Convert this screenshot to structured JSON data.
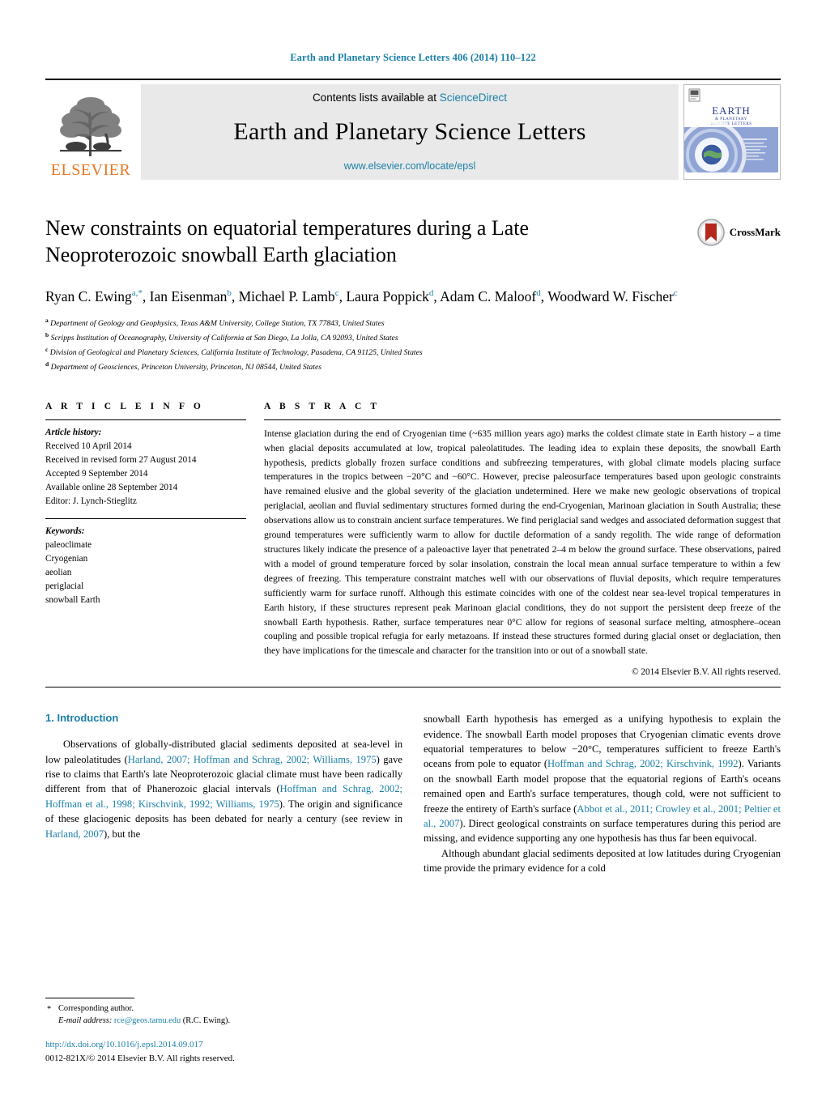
{
  "running_head": "Earth and Planetary Science Letters 406 (2014) 110–122",
  "banner": {
    "contents_prefix": "Contents lists available at ",
    "contents_link": "ScienceDirect",
    "journal_name": "Earth and Planetary Science Letters",
    "journal_url": "www.elsevier.com/locate/epsl",
    "publisher": "ELSEVIER",
    "cover_title_line1": "EARTH",
    "cover_title_line2": "& PLANETARY",
    "cover_title_line3": "SCIENCE LETTERS"
  },
  "article": {
    "title": "New constraints on equatorial temperatures during a Late Neoproterozoic snowball Earth glaciation",
    "crossmark_label": "CrossMark",
    "authors_line1": "Ryan C. Ewing",
    "authors": [
      {
        "name": "Ryan C. Ewing",
        "marks": "a,*"
      },
      {
        "name": "Ian Eisenman",
        "marks": "b"
      },
      {
        "name": "Michael P. Lamb",
        "marks": "c"
      },
      {
        "name": "Laura Poppick",
        "marks": "d"
      },
      {
        "name": "Adam C. Maloof",
        "marks": "d"
      },
      {
        "name": "Woodward W. Fischer",
        "marks": "c"
      }
    ],
    "affiliations": [
      {
        "mark": "a",
        "text": "Department of Geology and Geophysics, Texas A&M University, College Station, TX 77843, United States"
      },
      {
        "mark": "b",
        "text": "Scripps Institution of Oceanography, University of California at San Diego, La Jolla, CA 92093, United States"
      },
      {
        "mark": "c",
        "text": "Division of Geological and Planetary Sciences, California Institute of Technology, Pasadena, CA 91125, United States"
      },
      {
        "mark": "d",
        "text": "Department of Geosciences, Princeton University, Princeton, NJ 08544, United States"
      }
    ]
  },
  "article_info": {
    "heading": "A R T I C L E   I N F O",
    "history_label": "Article history:",
    "history": [
      "Received 10 April 2014",
      "Received in revised form 27 August 2014",
      "Accepted 9 September 2014",
      "Available online 28 September 2014",
      "Editor: J. Lynch-Stieglitz"
    ],
    "keywords_label": "Keywords:",
    "keywords": [
      "paleoclimate",
      "Cryogenian",
      "aeolian",
      "periglacial",
      "snowball Earth"
    ]
  },
  "abstract": {
    "heading": "A B S T R A C T",
    "text": "Intense glaciation during the end of Cryogenian time (~635 million years ago) marks the coldest climate state in Earth history – a time when glacial deposits accumulated at low, tropical paleolatitudes. The leading idea to explain these deposits, the snowball Earth hypothesis, predicts globally frozen surface conditions and subfreezing temperatures, with global climate models placing surface temperatures in the tropics between −20°C and −60°C. However, precise paleosurface temperatures based upon geologic constraints have remained elusive and the global severity of the glaciation undetermined. Here we make new geologic observations of tropical periglacial, aeolian and fluvial sedimentary structures formed during the end-Cryogenian, Marinoan glaciation in South Australia; these observations allow us to constrain ancient surface temperatures. We find periglacial sand wedges and associated deformation suggest that ground temperatures were sufficiently warm to allow for ductile deformation of a sandy regolith. The wide range of deformation structures likely indicate the presence of a paleoactive layer that penetrated 2–4 m below the ground surface. These observations, paired with a model of ground temperature forced by solar insolation, constrain the local mean annual surface temperature to within a few degrees of freezing. This temperature constraint matches well with our observations of fluvial deposits, which require temperatures sufficiently warm for surface runoff. Although this estimate coincides with one of the coldest near sea-level tropical temperatures in Earth history, if these structures represent peak Marinoan glacial conditions, they do not support the persistent deep freeze of the snowball Earth hypothesis. Rather, surface temperatures near 0°C allow for regions of seasonal surface melting, atmosphere–ocean coupling and possible tropical refugia for early metazoans. If instead these structures formed during glacial onset or deglaciation, then they have implications for the timescale and character for the transition into or out of a snowball state.",
    "copyright": "© 2014 Elsevier B.V. All rights reserved."
  },
  "body": {
    "section_heading": "1. Introduction",
    "left_paragraph_part1": "Observations of globally-distributed glacial sediments deposited at sea-level in low paleolatitudes (",
    "left_ref1": "Harland, 2007; Hoffman and Schrag, 2002; Williams, 1975",
    "left_paragraph_part2": ") gave rise to claims that Earth's late Neoproterozoic glacial climate must have been radically different from that of Phanerozoic glacial intervals (",
    "left_ref2": "Hoffman and Schrag, 2002; Hoffman et al., 1998; Kirschvink, 1992; Williams, 1975",
    "left_paragraph_part3": "). The origin and significance of these glaciogenic deposits has been debated for nearly a century (see review in ",
    "left_ref3": "Harland, 2007",
    "left_paragraph_part4": "), but the",
    "right_paragraph1_part1": "snowball Earth hypothesis has emerged as a unifying hypothesis to explain the evidence. The snowball Earth model proposes that Cryogenian climatic events drove equatorial temperatures to below −20°C, temperatures sufficient to freeze Earth's oceans from pole to equator (",
    "right_ref1": "Hoffman and Schrag, 2002; Kirschvink, 1992",
    "right_paragraph1_part2": "). Variants on the snowball Earth model propose that the equatorial regions of Earth's oceans remained open and Earth's surface temperatures, though cold, were not sufficient to freeze the entirety of Earth's surface (",
    "right_ref2": "Abbot et al., 2011; Crowley et al., 2001; Peltier et al., 2007",
    "right_paragraph1_part3": "). Direct geological constraints on surface temperatures during this period are missing, and evidence supporting any one hypothesis has thus far been equivocal.",
    "right_paragraph2": "Although abundant glacial sediments deposited at low latitudes during Cryogenian time provide the primary evidence for a cold"
  },
  "footnote": {
    "star": "*",
    "corresponding": "Corresponding author.",
    "email_label": "E-mail address:",
    "email": "rce@geos.tamu.edu",
    "email_suffix": "(R.C. Ewing).",
    "doi": "http://dx.doi.org/10.1016/j.epsl.2014.09.017",
    "issn_line": "0012-821X/© 2014 Elsevier B.V. All rights reserved."
  },
  "colors": {
    "link": "#1a7fa8",
    "elsevier_orange": "#e87722",
    "banner_bg": "#e9e9e9",
    "crossmark_red": "#b5281e"
  }
}
